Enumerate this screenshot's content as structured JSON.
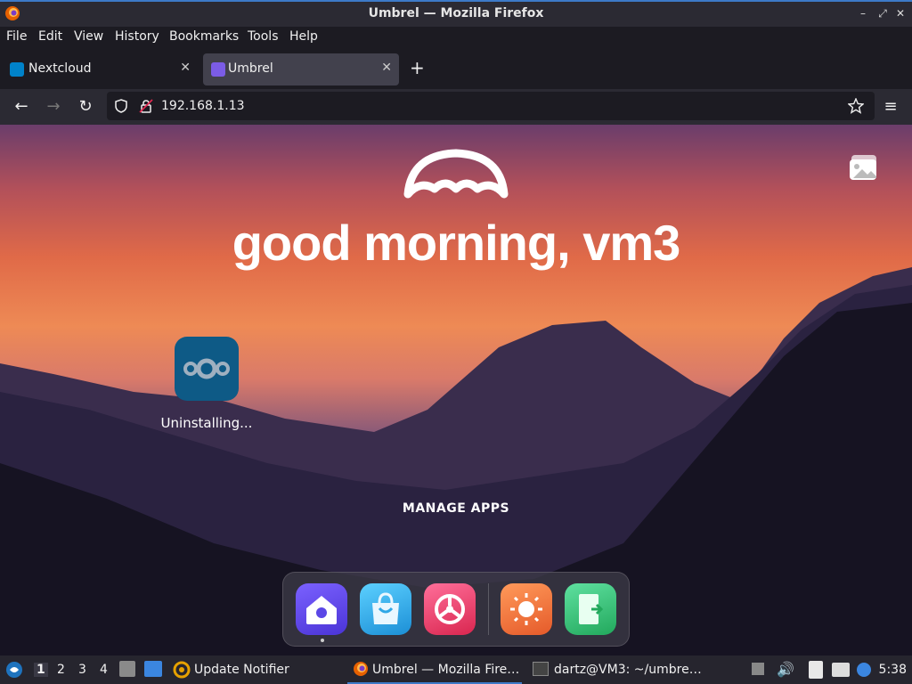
{
  "window": {
    "title": "Umbrel — Mozilla Firefox"
  },
  "menu": [
    "File",
    "Edit",
    "View",
    "History",
    "Bookmarks",
    "Tools",
    "Help"
  ],
  "tabs": [
    {
      "label": "Nextcloud",
      "icon": "nextcloud-icon",
      "active": false
    },
    {
      "label": "Umbrel",
      "icon": "umbrel-icon",
      "active": true
    }
  ],
  "address": {
    "url": "192.168.1.13"
  },
  "page": {
    "greeting": "good morning, vm3",
    "app": {
      "label": "Uninstalling...",
      "icon": "nextcloud-icon"
    },
    "manage_label": "MANAGE APPS",
    "dock": [
      {
        "name": "home",
        "icon": "home-icon",
        "color": "#5b47e6"
      },
      {
        "name": "app-store",
        "icon": "shopping-bag-icon",
        "color": "#2ea7e6"
      },
      {
        "name": "settings",
        "icon": "settings-icon",
        "color": "#e63a6e"
      },
      {
        "name": "theme",
        "icon": "sun-icon",
        "color": "#f0733a"
      },
      {
        "name": "logout",
        "icon": "door-exit-icon",
        "color": "#3ac37a"
      }
    ]
  },
  "taskbar": {
    "workspaces": [
      "1",
      "2",
      "3",
      "4"
    ],
    "update_notifier": "Update Notifier",
    "firefox_task": "Umbrel — Mozilla Fire…",
    "terminal_task": "dartz@VM3: ~/umbre…",
    "clock": "5:38"
  }
}
